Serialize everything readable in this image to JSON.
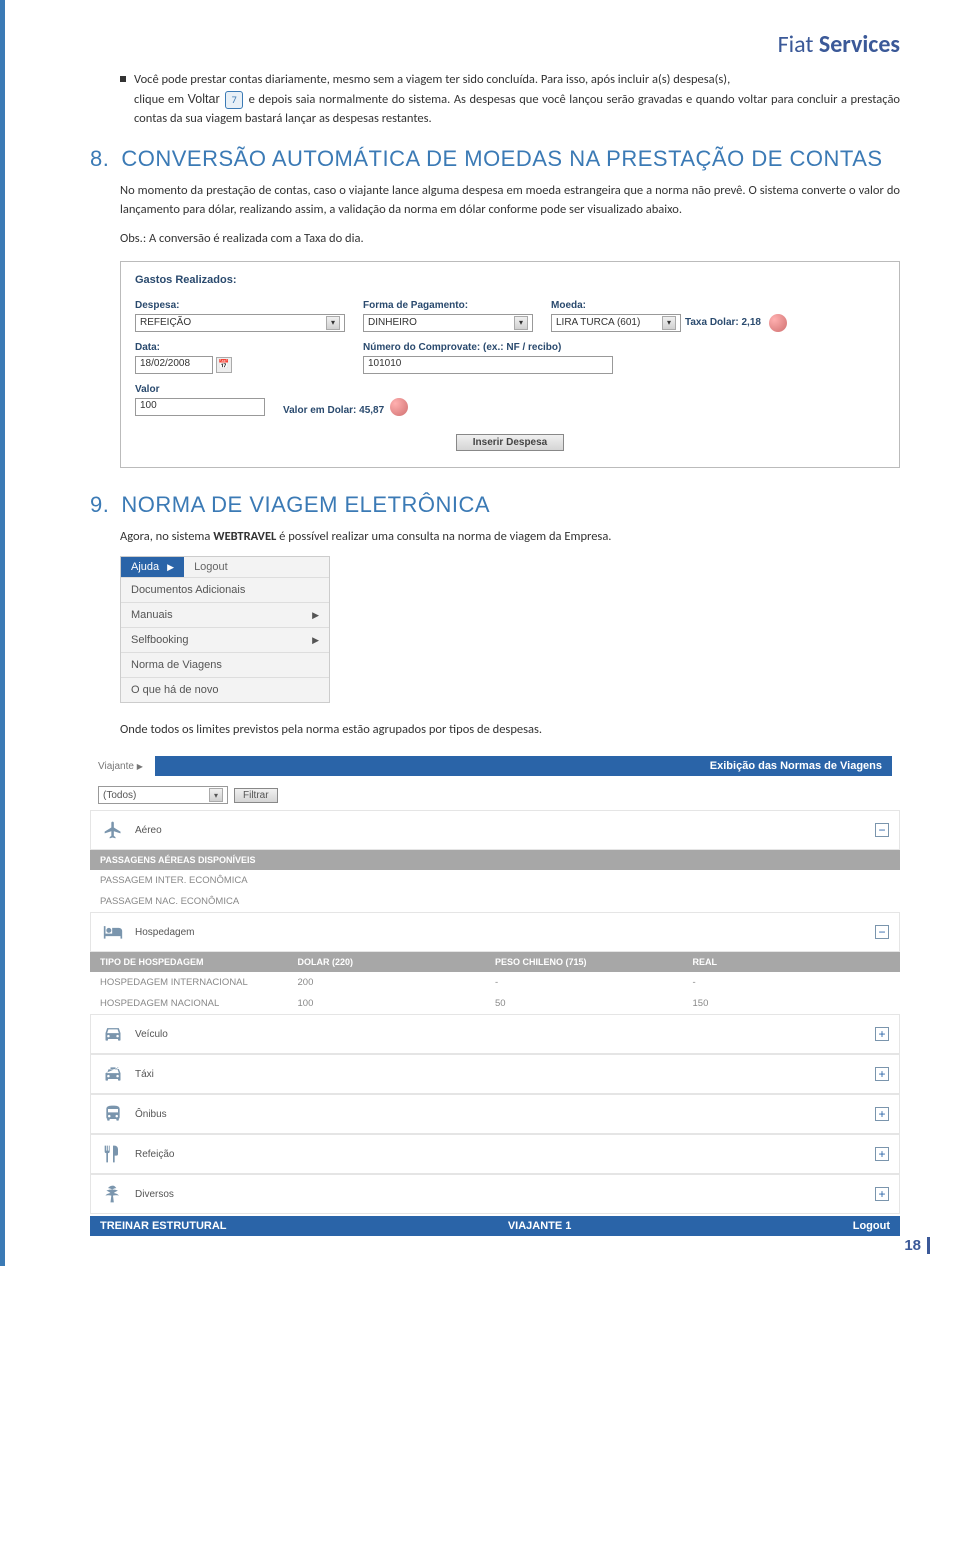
{
  "brand": {
    "light": "Fiat",
    "bold": "Services"
  },
  "bullet": {
    "part1": "Você pode prestar contas diariamente, mesmo sem a viagem ter sido concluída. Para isso,  após incluir a(s) despesa(s),",
    "part2a": "clique em ",
    "voltar": "Voltar",
    "refnum": "7",
    "part2b": " e depois saia normalmente do sistema. As despesas que você lançou serão gravadas e quando voltar para concluir a prestação contas da sua viagem bastará lançar as despesas restantes."
  },
  "section8": {
    "num": "8.",
    "title": "CONVERSÃO AUTOMÁTICA DE MOEDAS NA PRESTAÇÃO DE CONTAS",
    "p1": "No momento da prestação de contas, caso o viajante lance alguma despesa em moeda estrangeira que a norma não prevê. O sistema converte o valor do lançamento para dólar, realizando assim, a validação da norma em dólar conforme pode ser visualizado abaixo.",
    "p2": "Obs.: A conversão é realizada com a Taxa do dia."
  },
  "gastos": {
    "title": "Gastos Realizados:",
    "despesa_label": "Despesa:",
    "despesa_value": "REFEIÇÃO",
    "forma_label": "Forma de Pagamento:",
    "forma_value": "DINHEIRO",
    "moeda_label": "Moeda:",
    "moeda_value": "LIRA TURCA (601)",
    "taxa_label": "Taxa Dolar: 2,18",
    "data_label": "Data:",
    "data_value": "18/02/2008",
    "comprov_label": "Número do Comprovate: (ex.: NF / recibo)",
    "comprov_value": "101010",
    "valor_label": "Valor",
    "valor_value": "100",
    "valor_dolar_label": "Valor em Dolar: 45,87",
    "insert_btn": "Inserir Despesa"
  },
  "section9": {
    "num": "9.",
    "title": "NORMA DE VIAGEM ELETRÔNICA",
    "p1a": "Agora, no sistema ",
    "p1bold": "WEBTRAVEL",
    "p1b": " é possível realizar uma consulta na norma de viagem da Empresa.",
    "p2": "Onde todos os limites previstos pela norma estão agrupados por tipos de despesas."
  },
  "menu": {
    "ajuda": "Ajuda",
    "logout": "Logout",
    "items": [
      {
        "label": "Documentos Adicionais",
        "arrow": false
      },
      {
        "label": "Manuais",
        "arrow": true
      },
      {
        "label": "Selfbooking",
        "arrow": true
      },
      {
        "label": "Norma de Viagens",
        "arrow": false
      },
      {
        "label": "O que há de novo",
        "arrow": false
      }
    ]
  },
  "normas": {
    "viajante": "Viajante",
    "banner": "Exibição das Normas de Viagens",
    "todos": "(Todos)",
    "filtrar": "Filtrar",
    "cats": {
      "aereo": {
        "label": "Aéreo",
        "open": true,
        "subhead": "PASSAGENS AÉREAS DISPONÍVEIS",
        "rows": [
          "PASSAGEM INTER. ECONÔMICA",
          "PASSAGEM NAC. ECONÔMICA"
        ]
      },
      "hospedagem": {
        "label": "Hospedagem",
        "open": true,
        "cols": [
          "TIPO DE HOSPEDAGEM",
          "DOLAR (220)",
          "PESO CHILENO (715)",
          "REAL"
        ],
        "rows": [
          [
            "HOSPEDAGEM INTERNACIONAL",
            "200",
            "-",
            "-"
          ],
          [
            "HOSPEDAGEM NACIONAL",
            "100",
            "50",
            "150"
          ]
        ]
      },
      "veiculo": {
        "label": "Veículo"
      },
      "taxi": {
        "label": "Táxi"
      },
      "onibus": {
        "label": "Ônibus"
      },
      "refeicao": {
        "label": "Refeição"
      },
      "diversos": {
        "label": "Diversos"
      }
    },
    "footer": {
      "left": "TREINAR ESTRUTURAL",
      "mid": "VIAJANTE 1",
      "right": "Logout"
    }
  },
  "page_num": "18"
}
